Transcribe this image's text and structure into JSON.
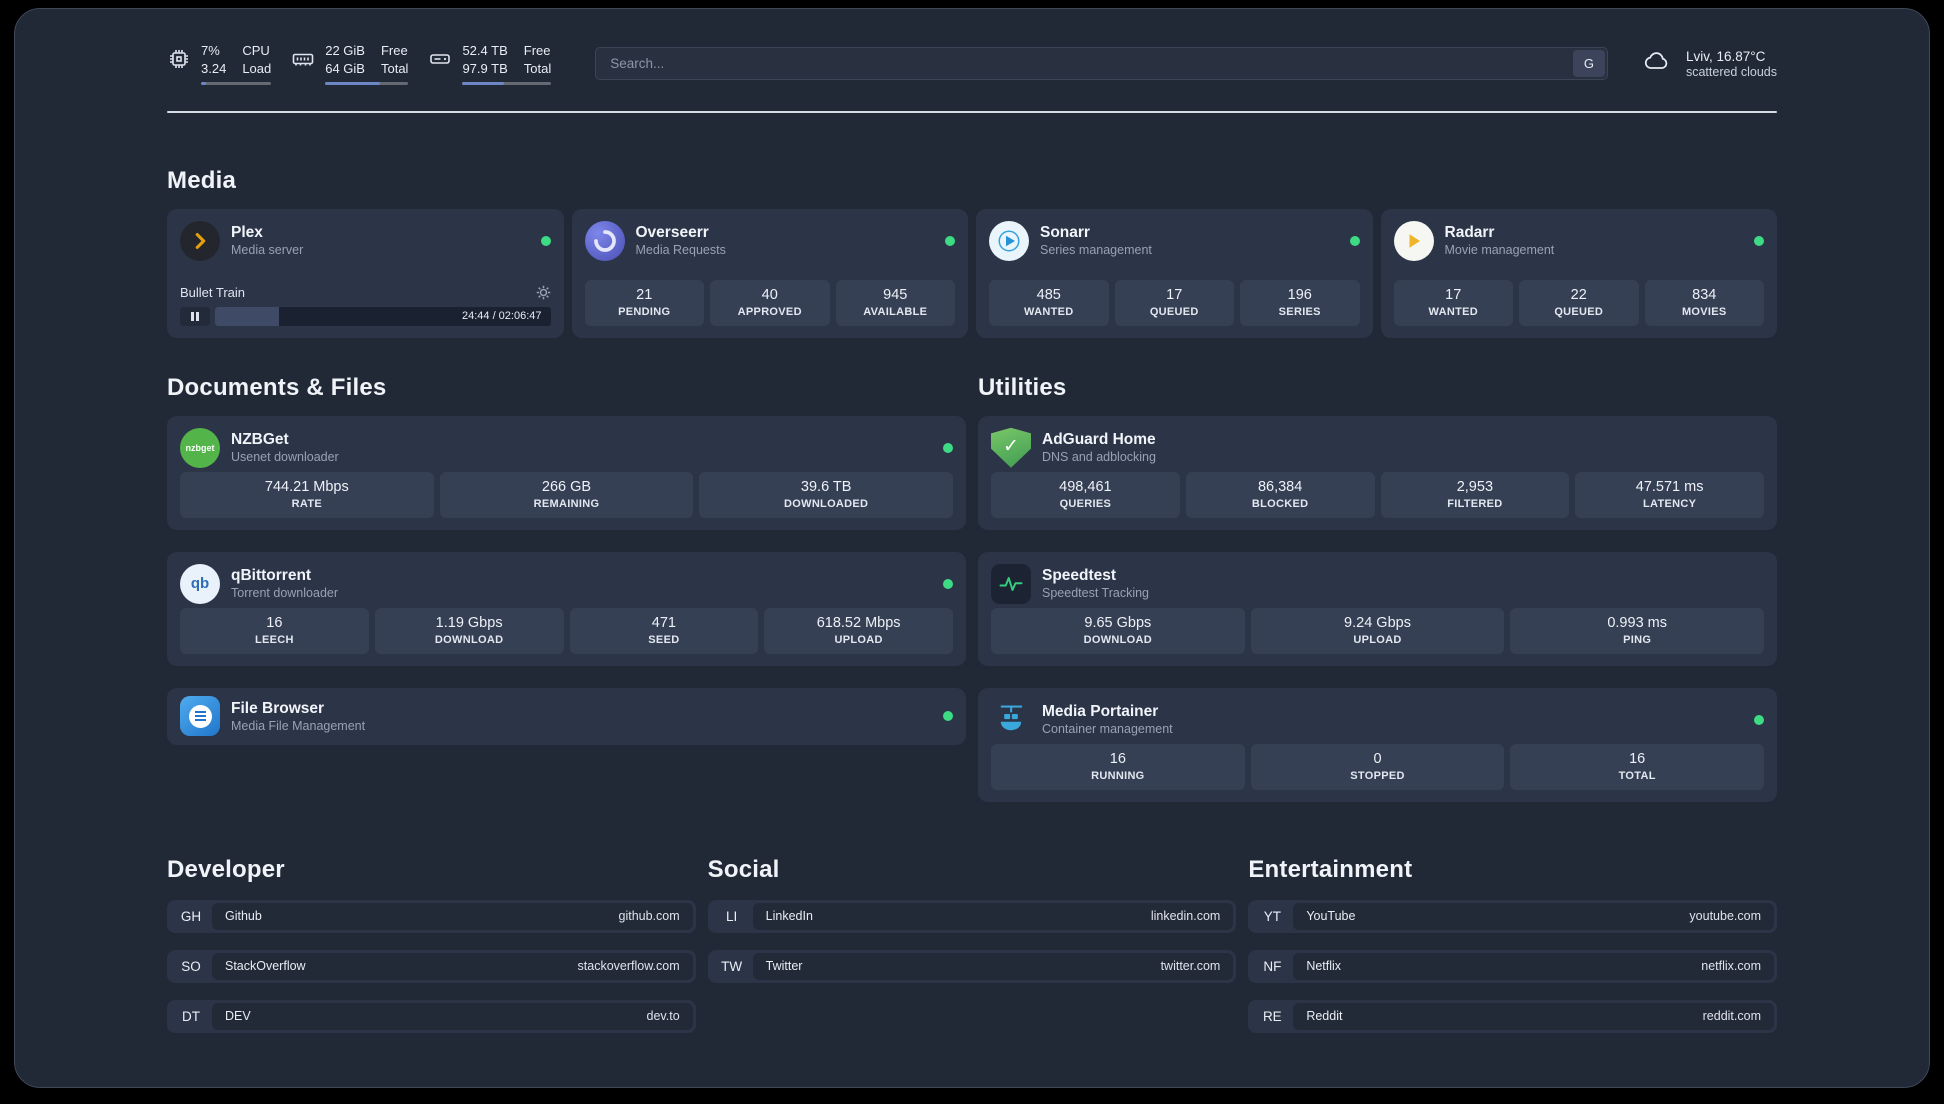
{
  "colors": {
    "panel_bg": "#212937",
    "card_bg": "#2c3447",
    "tile_bg": "#364054",
    "status_green": "#3ddc84",
    "plex_amber": "#e5a00d",
    "radarr_gold": "#f0b429",
    "sonarr_blue": "#2793d6",
    "adguard_green": "#4f9e52",
    "speedtest_green": "#35d07f",
    "portainer_blue": "#3aa7dd"
  },
  "header": {
    "cpu": {
      "usage": "7%",
      "load": "3.24",
      "label_top": "CPU",
      "label_bottom": "Load",
      "bar_percent": 7
    },
    "memory": {
      "free": "22 GiB",
      "total": "64 GiB",
      "label_top": "Free",
      "label_bottom": "Total",
      "bar_percent": 66
    },
    "disk": {
      "free": "52.4 TB",
      "total": "97.9 TB",
      "label_top": "Free",
      "label_bottom": "Total",
      "bar_percent": 47
    },
    "search": {
      "placeholder": "Search...",
      "button": "G"
    },
    "weather": {
      "location": "Lviv, 16.87°C",
      "condition": "scattered clouds"
    }
  },
  "sections": {
    "media": {
      "title": "Media",
      "apps": [
        {
          "name": "Plex",
          "subtitle": "Media server",
          "player": {
            "track": "Bullet Train",
            "time": "24:44 / 02:06:47",
            "progress_percent": 19
          }
        },
        {
          "name": "Overseerr",
          "subtitle": "Media Requests",
          "stats": [
            {
              "value": "21",
              "label": "PENDING"
            },
            {
              "value": "40",
              "label": "APPROVED"
            },
            {
              "value": "945",
              "label": "AVAILABLE"
            }
          ]
        },
        {
          "name": "Sonarr",
          "subtitle": "Series management",
          "stats": [
            {
              "value": "485",
              "label": "WANTED"
            },
            {
              "value": "17",
              "label": "QUEUED"
            },
            {
              "value": "196",
              "label": "SERIES"
            }
          ]
        },
        {
          "name": "Radarr",
          "subtitle": "Movie management",
          "stats": [
            {
              "value": "17",
              "label": "WANTED"
            },
            {
              "value": "22",
              "label": "QUEUED"
            },
            {
              "value": "834",
              "label": "MOVIES"
            }
          ]
        }
      ]
    },
    "documents": {
      "title": "Documents & Files",
      "apps": [
        {
          "name": "NZBGet",
          "subtitle": "Usenet downloader",
          "stats": [
            {
              "value": "744.21 Mbps",
              "label": "RATE"
            },
            {
              "value": "266 GB",
              "label": "REMAINING"
            },
            {
              "value": "39.6 TB",
              "label": "DOWNLOADED"
            }
          ]
        },
        {
          "name": "qBittorrent",
          "subtitle": "Torrent downloader",
          "stats": [
            {
              "value": "16",
              "label": "LEECH"
            },
            {
              "value": "1.19 Gbps",
              "label": "DOWNLOAD"
            },
            {
              "value": "471",
              "label": "SEED"
            },
            {
              "value": "618.52 Mbps",
              "label": "UPLOAD"
            }
          ]
        },
        {
          "name": "File Browser",
          "subtitle": "Media File Management",
          "stats": []
        }
      ]
    },
    "utilities": {
      "title": "Utilities",
      "apps": [
        {
          "name": "AdGuard Home",
          "subtitle": "DNS and adblocking",
          "stats": [
            {
              "value": "498,461",
              "label": "QUERIES"
            },
            {
              "value": "86,384",
              "label": "BLOCKED"
            },
            {
              "value": "2,953",
              "label": "FILTERED"
            },
            {
              "value": "47.571 ms",
              "label": "LATENCY"
            }
          ]
        },
        {
          "name": "Speedtest",
          "subtitle": "Speedtest Tracking",
          "stats": [
            {
              "value": "9.65 Gbps",
              "label": "DOWNLOAD"
            },
            {
              "value": "9.24 Gbps",
              "label": "UPLOAD"
            },
            {
              "value": "0.993 ms",
              "label": "PING"
            }
          ]
        },
        {
          "name": "Media Portainer",
          "subtitle": "Container management",
          "stats": [
            {
              "value": "16",
              "label": "RUNNING"
            },
            {
              "value": "0",
              "label": "STOPPED"
            },
            {
              "value": "16",
              "label": "TOTAL"
            }
          ]
        }
      ]
    },
    "bookmark_groups": [
      {
        "title": "Developer",
        "links": [
          {
            "abbr": "GH",
            "name": "Github",
            "domain": "github.com"
          },
          {
            "abbr": "SO",
            "name": "StackOverflow",
            "domain": "stackoverflow.com"
          },
          {
            "abbr": "DT",
            "name": "DEV",
            "domain": "dev.to"
          }
        ]
      },
      {
        "title": "Social",
        "links": [
          {
            "abbr": "LI",
            "name": "LinkedIn",
            "domain": "linkedin.com"
          },
          {
            "abbr": "TW",
            "name": "Twitter",
            "domain": "twitter.com"
          }
        ]
      },
      {
        "title": "Entertainment",
        "links": [
          {
            "abbr": "YT",
            "name": "YouTube",
            "domain": "youtube.com"
          },
          {
            "abbr": "NF",
            "name": "Netflix",
            "domain": "netflix.com"
          },
          {
            "abbr": "RE",
            "name": "Reddit",
            "domain": "reddit.com"
          }
        ]
      }
    ]
  }
}
